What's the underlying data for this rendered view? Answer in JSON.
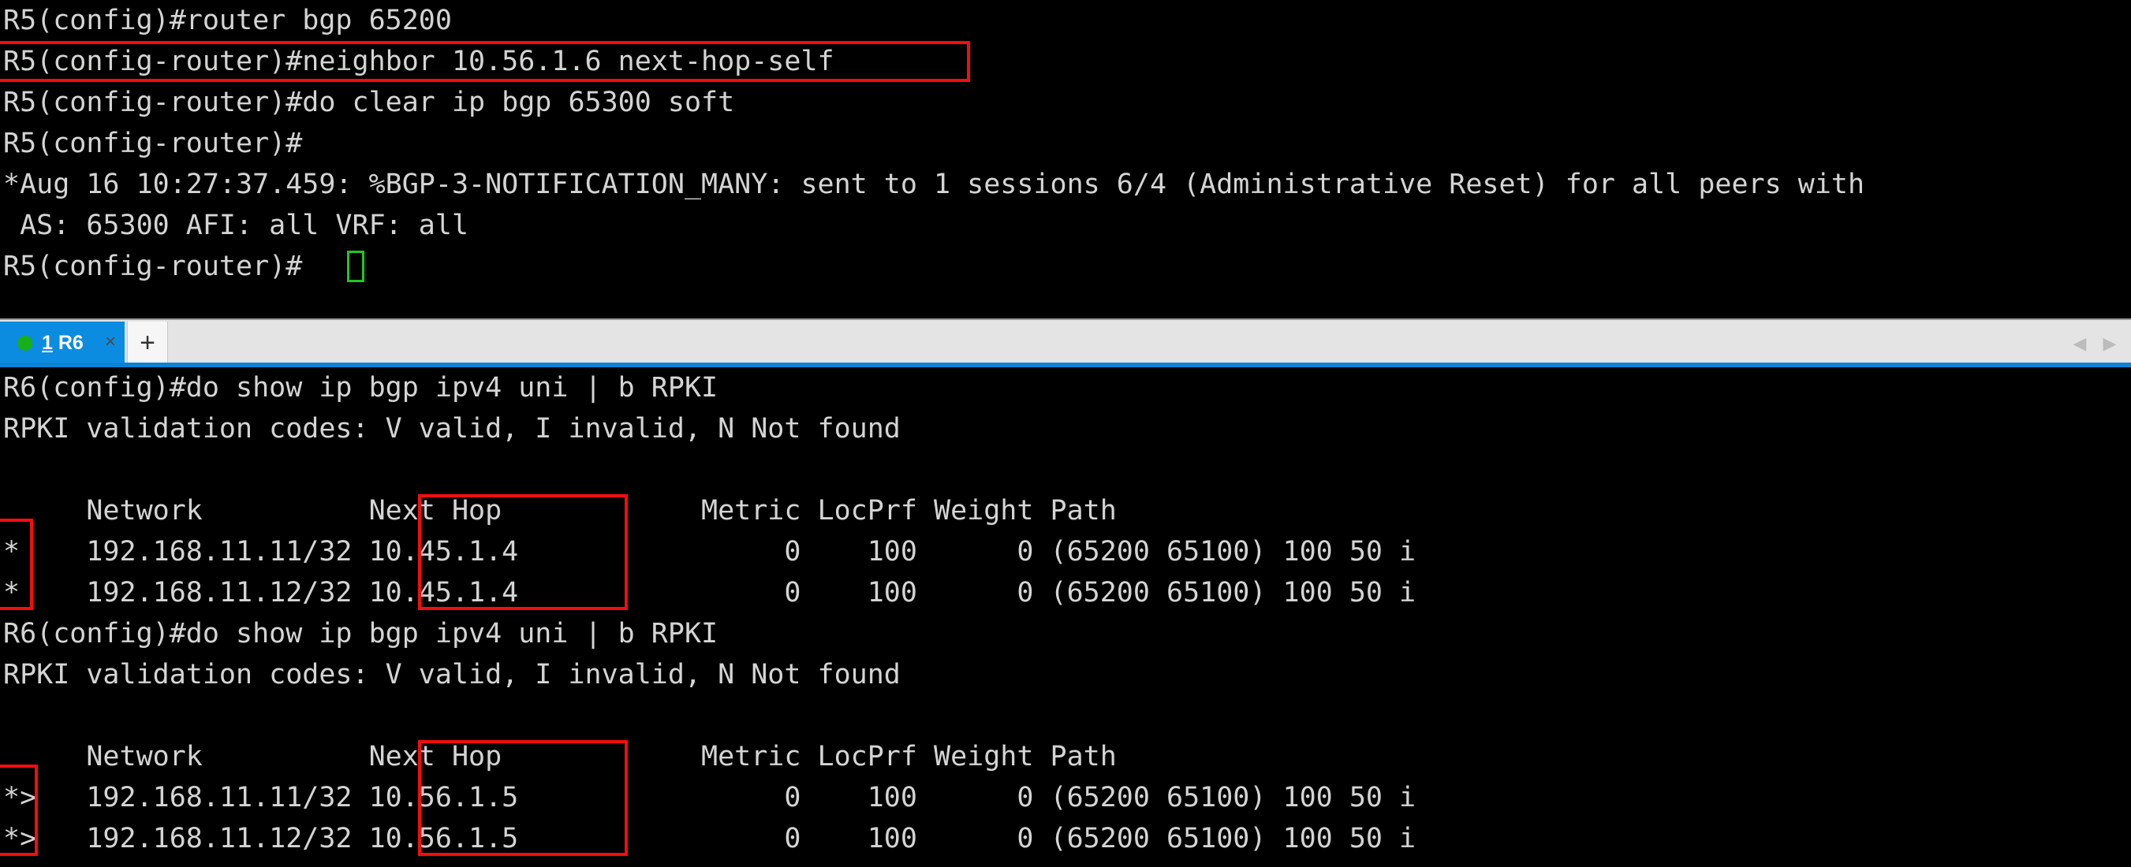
{
  "window": {
    "title": "Terminal - R5 / R6 BGP next-hop-self",
    "background_color": "#000000",
    "foreground_color": "#d4d4d4",
    "highlight_color": "#f40d0d",
    "cursor_color": "#22c522"
  },
  "top_pane": {
    "name": "R5 console",
    "lines": [
      "R5(config)#router bgp 65200",
      "R5(config-router)#neighbor 10.56.1.6 next-hop-self",
      "R5(config-router)#do clear ip bgp 65300 soft",
      "R5(config-router)#",
      "*Aug 16 10:27:37.459: %BGP-3-NOTIFICATION_MANY: sent to 1 sessions 6/4 (Administrative Reset) for all peers with",
      " AS: 65300 AFI: all VRF: all",
      "R5(config-router)#"
    ],
    "highlighted_line": "R5(config-router)#neighbor 10.56.1.6 next-hop-self"
  },
  "tabbar": {
    "tabs": [
      {
        "index": "1",
        "name": "R6",
        "label": " R6",
        "status_dot": "connected-green",
        "close_icon": "×",
        "active": true
      }
    ],
    "new_tab_icon": "+",
    "scroll_left_icon": "◀",
    "scroll_right_icon": "▶"
  },
  "bottom_pane": {
    "name": "R6 console",
    "blocks": [
      {
        "command": "R6(config)#do show ip bgp ipv4 uni | b RPKI",
        "rpki_legend": "RPKI validation codes: V valid, I invalid, N Not found",
        "headers": {
          "status": "",
          "network": "Network",
          "next_hop": "Next Hop",
          "metric": "Metric",
          "locprf": "LocPrf",
          "weight": "Weight",
          "path": "Path"
        },
        "header_line": "     Network          Next Hop            Metric LocPrf Weight Path",
        "rows": [
          {
            "status": "*",
            "network": "192.168.11.11/32",
            "next_hop": "10.45.1.4",
            "metric": "0",
            "locprf": "100",
            "weight": "0",
            "path": "(65200 65100) 100 50 i",
            "line": "*    192.168.11.11/32 10.45.1.4                0    100      0 (65200 65100) 100 50 i"
          },
          {
            "status": "*",
            "network": "192.168.11.12/32",
            "next_hop": "10.45.1.4",
            "metric": "0",
            "locprf": "100",
            "weight": "0",
            "path": "(65200 65100) 100 50 i",
            "line": "*    192.168.11.12/32 10.45.1.4                0    100      0 (65200 65100) 100 50 i"
          }
        ]
      },
      {
        "command": "R6(config)#do show ip bgp ipv4 uni | b RPKI",
        "rpki_legend": "RPKI validation codes: V valid, I invalid, N Not found",
        "headers": {
          "status": "",
          "network": "Network",
          "next_hop": "Next Hop",
          "metric": "Metric",
          "locprf": "LocPrf",
          "weight": "Weight",
          "path": "Path"
        },
        "header_line": "     Network          Next Hop            Metric LocPrf Weight Path",
        "rows": [
          {
            "status": "*>",
            "network": "192.168.11.11/32",
            "next_hop": "10.56.1.5",
            "metric": "0",
            "locprf": "100",
            "weight": "0",
            "path": "(65200 65100) 100 50 i",
            "line": "*>   192.168.11.11/32 10.56.1.5                0    100      0 (65200 65100) 100 50 i"
          },
          {
            "status": "*>",
            "network": "192.168.11.12/32",
            "next_hop": "10.56.1.5",
            "metric": "0",
            "locprf": "100",
            "weight": "0",
            "path": "(65200 65100) 100 50 i",
            "line": "*>   192.168.11.12/32 10.56.1.5                0    100      0 (65200 65100) 100 50 i"
          }
        ]
      }
    ]
  }
}
